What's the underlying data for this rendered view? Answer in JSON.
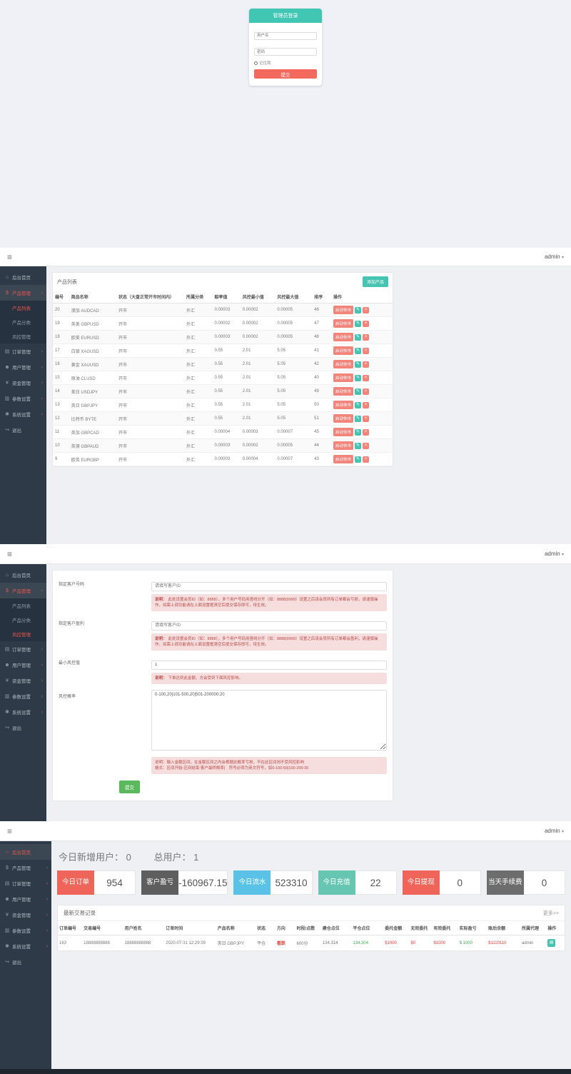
{
  "login": {
    "title": "管理员登录",
    "username_placeholder": "用户名",
    "password_placeholder": "密码",
    "remember_label": "记住我",
    "submit_label": "提交"
  },
  "topbar": {
    "user_menu": "admin",
    "caret": "▾",
    "hamburger": "≡"
  },
  "admin_sidebar": {
    "items": [
      {
        "icon": "home-icon",
        "label": "后台首页",
        "has_children": false
      },
      {
        "icon": "product-icon",
        "label": "产品管理",
        "has_children": true,
        "children": [
          "产品列表",
          "产品分类",
          "风控管理"
        ]
      },
      {
        "icon": "orders-icon",
        "label": "订单管理",
        "has_children": true
      },
      {
        "icon": "users-icon",
        "label": "用户管理",
        "has_children": true
      },
      {
        "icon": "funds-icon",
        "label": "资金管理",
        "has_children": true
      },
      {
        "icon": "params-icon",
        "label": "参数设置",
        "has_children": true
      },
      {
        "icon": "system-icon",
        "label": "系统设置",
        "has_children": true
      },
      {
        "icon": "logout-icon",
        "label": "退出",
        "has_children": false
      }
    ]
  },
  "product_list_page": {
    "panel_title": "产品列表",
    "add_button_label": "添加产品",
    "columns": [
      "编号",
      "商品名称",
      "状态（大盘正常开市时间内）",
      "所属分类",
      "赔率值",
      "风控最小值",
      "风控最大值",
      "排序",
      "操作"
    ],
    "row_action_labels": {
      "toggle": "启动休市",
      "edit_icon": "pencil-icon",
      "delete_icon": "trash-icon"
    },
    "rows": [
      {
        "id": "20",
        "name": "澳加 AUDCAD",
        "status": "开市",
        "category": "外汇",
        "odds": "0.00003",
        "risk_min": "0.00002",
        "risk_max": "0.00005",
        "sort": "46"
      },
      {
        "id": "19",
        "name": "英美 GBPUSD",
        "status": "开市",
        "category": "外汇",
        "odds": "0.00002",
        "risk_min": "0.00002",
        "risk_max": "0.00005",
        "sort": "47"
      },
      {
        "id": "18",
        "name": "欧美 EURUSD",
        "status": "开市",
        "category": "外汇",
        "odds": "0.00003",
        "risk_min": "0.00002",
        "risk_max": "0.00005",
        "sort": "48"
      },
      {
        "id": "17",
        "name": "白银 XAGUSD",
        "status": "开市",
        "category": "外汇",
        "odds": "0.55",
        "risk_min": "2.01",
        "risk_max": "5.05",
        "sort": "41"
      },
      {
        "id": "16",
        "name": "黄金 XAUUSD",
        "status": "开市",
        "category": "外汇",
        "odds": "0.55",
        "risk_min": "2.01",
        "risk_max": "5.05",
        "sort": "42"
      },
      {
        "id": "15",
        "name": "原油 CLUSD",
        "status": "开市",
        "category": "外汇",
        "odds": "0.55",
        "risk_min": "2.01",
        "risk_max": "5.05",
        "sort": "40"
      },
      {
        "id": "14",
        "name": "美日 USDJPY",
        "status": "开市",
        "category": "外汇",
        "odds": "0.55",
        "risk_min": "2.01",
        "risk_max": "5.05",
        "sort": "49"
      },
      {
        "id": "13",
        "name": "英日 GBPJPY",
        "status": "开市",
        "category": "外汇",
        "odds": "0.55",
        "risk_min": "2.01",
        "risk_max": "5.05",
        "sort": "50"
      },
      {
        "id": "12",
        "name": "比特币 BYTE",
        "status": "开市",
        "category": "外汇",
        "odds": "0.55",
        "risk_min": "2.01",
        "risk_max": "5.05",
        "sort": "51"
      },
      {
        "id": "11",
        "name": "英加 GBPCAD",
        "status": "开市",
        "category": "外汇",
        "odds": "0.00004",
        "risk_min": "0.00003",
        "risk_max": "0.00007",
        "sort": "45"
      },
      {
        "id": "10",
        "name": "英澳 GBPAUD",
        "status": "开市",
        "category": "外汇",
        "odds": "0.00003",
        "risk_min": "0.00002",
        "risk_max": "0.00005",
        "sort": "44"
      },
      {
        "id": "9",
        "name": "欧英 EURGBP",
        "status": "开市",
        "category": "外汇",
        "odds": "0.00003",
        "risk_min": "0.00004",
        "risk_max": "0.00007",
        "sort": "43"
      }
    ]
  },
  "risk_page": {
    "fields": [
      {
        "label": "指定客户号码",
        "placeholder": "请填写客户ID",
        "note_tag": "说明：",
        "note": "此处设置会员ID（如：8888），多个用户号码用竖线分开（如：8888|9999）设置之后该会员所有订单都会亏损，请谨慎操作，如需上调功能请在上面设置框清空后提交保存即可，待生效。"
      },
      {
        "label": "指定客户盈利",
        "placeholder": "请填写客户ID",
        "note_tag": "说明：",
        "note": "此处设置会员ID（如：8888），多个用户号码用竖线分开（如：8888|9999）设置之后该会员所有订单都会盈利，请谨慎操作，如需上调功能请在上面设置框清空后提交保存即可，待生效。"
      },
      {
        "label": "最小风控值",
        "value": "1",
        "note_tag": "说明：",
        "note": "下单达到此金额，方会受到下面风控影响。"
      }
    ],
    "textarea": {
      "label": "风控概率",
      "value": "0-100,20|101-500,20|501-200000:20"
    },
    "textarea_note_line1": "说明：输入金额区间，在金额区间之内会根据此概率亏损，不在此区间则不受风控影响",
    "textarea_note_line2": "格式：区间开始-区间结束:客户最终概率|　符号必须为英文符号，如0-100:50|100-200:30",
    "submit_label": "提交"
  },
  "dashboard": {
    "new_users_label": "今日新增用户： 0",
    "total_users_label": "总用户： 1",
    "stats": [
      {
        "label": "今日订单",
        "value": "954",
        "color": "#f0655a"
      },
      {
        "label": "客户盈亏",
        "value": "-160967.15",
        "color": "#5e5e5e"
      },
      {
        "label": "今日流水",
        "value": "523310",
        "color": "#59c2e6"
      },
      {
        "label": "今日充值",
        "value": "22",
        "color": "#67c6b2"
      },
      {
        "label": "今日提现",
        "value": "0",
        "color": "#f0655a"
      },
      {
        "label": "当天手续费",
        "value": "0",
        "color": "#6d6d6d"
      }
    ],
    "recent_panel": {
      "title": "最新交易记录",
      "more_link": "更多>>",
      "columns": [
        "订单编号",
        "交易编号",
        "用户姓名",
        "订单时间",
        "产品名称",
        "状态",
        "方向",
        "时段/点数",
        "建仓点位",
        "平仓点位",
        "委托金额",
        "无效委托",
        "有效委托",
        "实际盈亏",
        "账后余额",
        "所属代理",
        "操作"
      ],
      "rows": [
        {
          "order_no": "163",
          "trade_no": "18888888888",
          "user_name": "18888888888",
          "time": "2020-07-31 12:29:39",
          "product": "英日 GBPJPY",
          "status": "平仓",
          "direction": "看跌",
          "period": "600分",
          "open_point": "134.314",
          "close_point": "134.304",
          "amount": "$1000",
          "invalid_amount": "$0",
          "valid_amount": "$1000",
          "profit": "$ 1000",
          "balance": "$1110110",
          "agent": "admin"
        }
      ]
    }
  },
  "colors": {
    "teal": "#41c6b4",
    "salmon": "#f4695e",
    "sidebar_bg": "#2e3a48",
    "active_red": "#e8554a",
    "green": "#5cb85c"
  }
}
